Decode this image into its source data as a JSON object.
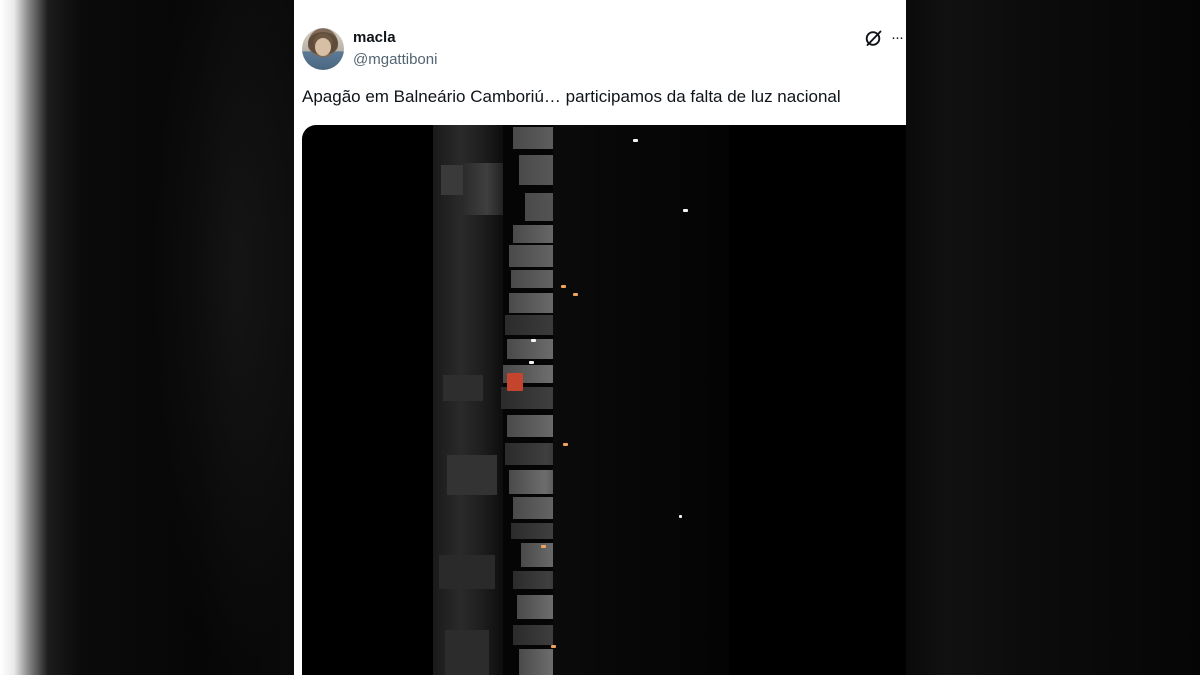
{
  "tweet": {
    "display_name": "macla",
    "handle": "@mgattiboni",
    "text": "Apagão em Balneário Camboriú… participamos da falta de luz nacional",
    "more_label": "···"
  },
  "icons": {
    "grok": "grok-icon",
    "more": "more-options-icon",
    "avatar": "user-avatar"
  },
  "media": {
    "description_colors": {
      "background": "#000000",
      "building_lights": "#f0a45a"
    }
  }
}
